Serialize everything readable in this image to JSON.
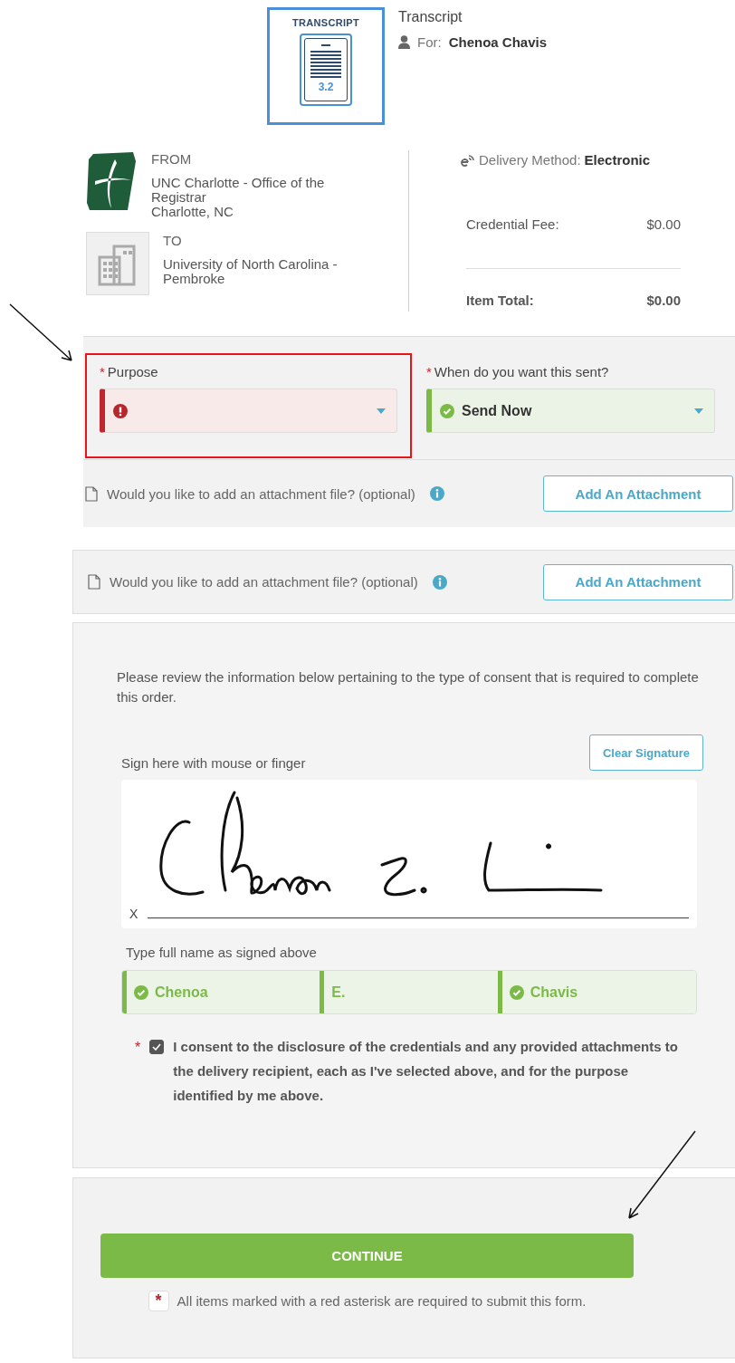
{
  "product": {
    "badge_title": "TRANSCRIPT",
    "badge_version": "3.2",
    "title": "Transcript",
    "for_label": "For:",
    "for_name": "Chenoa Chavis"
  },
  "from": {
    "label": "FROM",
    "name": "UNC Charlotte - Office of the Registrar",
    "location": "Charlotte, NC"
  },
  "to": {
    "label": "TO",
    "name": "University of North Carolina - Pembroke"
  },
  "delivery": {
    "label": "Delivery Method:",
    "value": "Electronic"
  },
  "fees": [
    {
      "label": "Credential Fee:",
      "value": "$0.00",
      "kind": "line"
    },
    {
      "label": "Item Total:",
      "value": "$0.00",
      "kind": "total"
    }
  ],
  "selects": [
    {
      "label": "Purpose",
      "required_mark": "*",
      "valid": false,
      "highlighted": true
    },
    {
      "label": "When do you want this sent?",
      "required_mark": "*",
      "value": "Send Now",
      "valid": true,
      "highlighted": false
    }
  ],
  "attachments": [
    {
      "question": "Would you like to add an attachment file? (optional)",
      "button": "Add An Attachment",
      "kind": "plain"
    },
    {
      "question": "Would you like to add an attachment file? (optional)",
      "button": "Add An Attachment",
      "kind": "bordered"
    }
  ],
  "consent": {
    "intro": "Please review the information below pertaining to the type of consent that is required to complete this order.",
    "clear_button": "Clear Signature",
    "sign_label": "Sign here with mouse or finger",
    "x_mark": "X",
    "name_label": "Type full name as signed above",
    "name_fields": [
      {
        "value": "Chenoa",
        "valid": true,
        "icon": true
      },
      {
        "value": "E.",
        "valid": true,
        "icon": false
      },
      {
        "value": "Chavis",
        "valid": true,
        "icon": true
      }
    ],
    "agreement": {
      "required_mark": "*",
      "checked": true,
      "text": "I consent to the disclosure of the credentials and any provided attachments to the delivery recipient, each as I've selected above, and for the purpose identified by me above."
    }
  },
  "footer": {
    "button": "CONTINUE",
    "note_mark": "*",
    "note": "All items marked with a red asterisk are required to submit this form."
  }
}
